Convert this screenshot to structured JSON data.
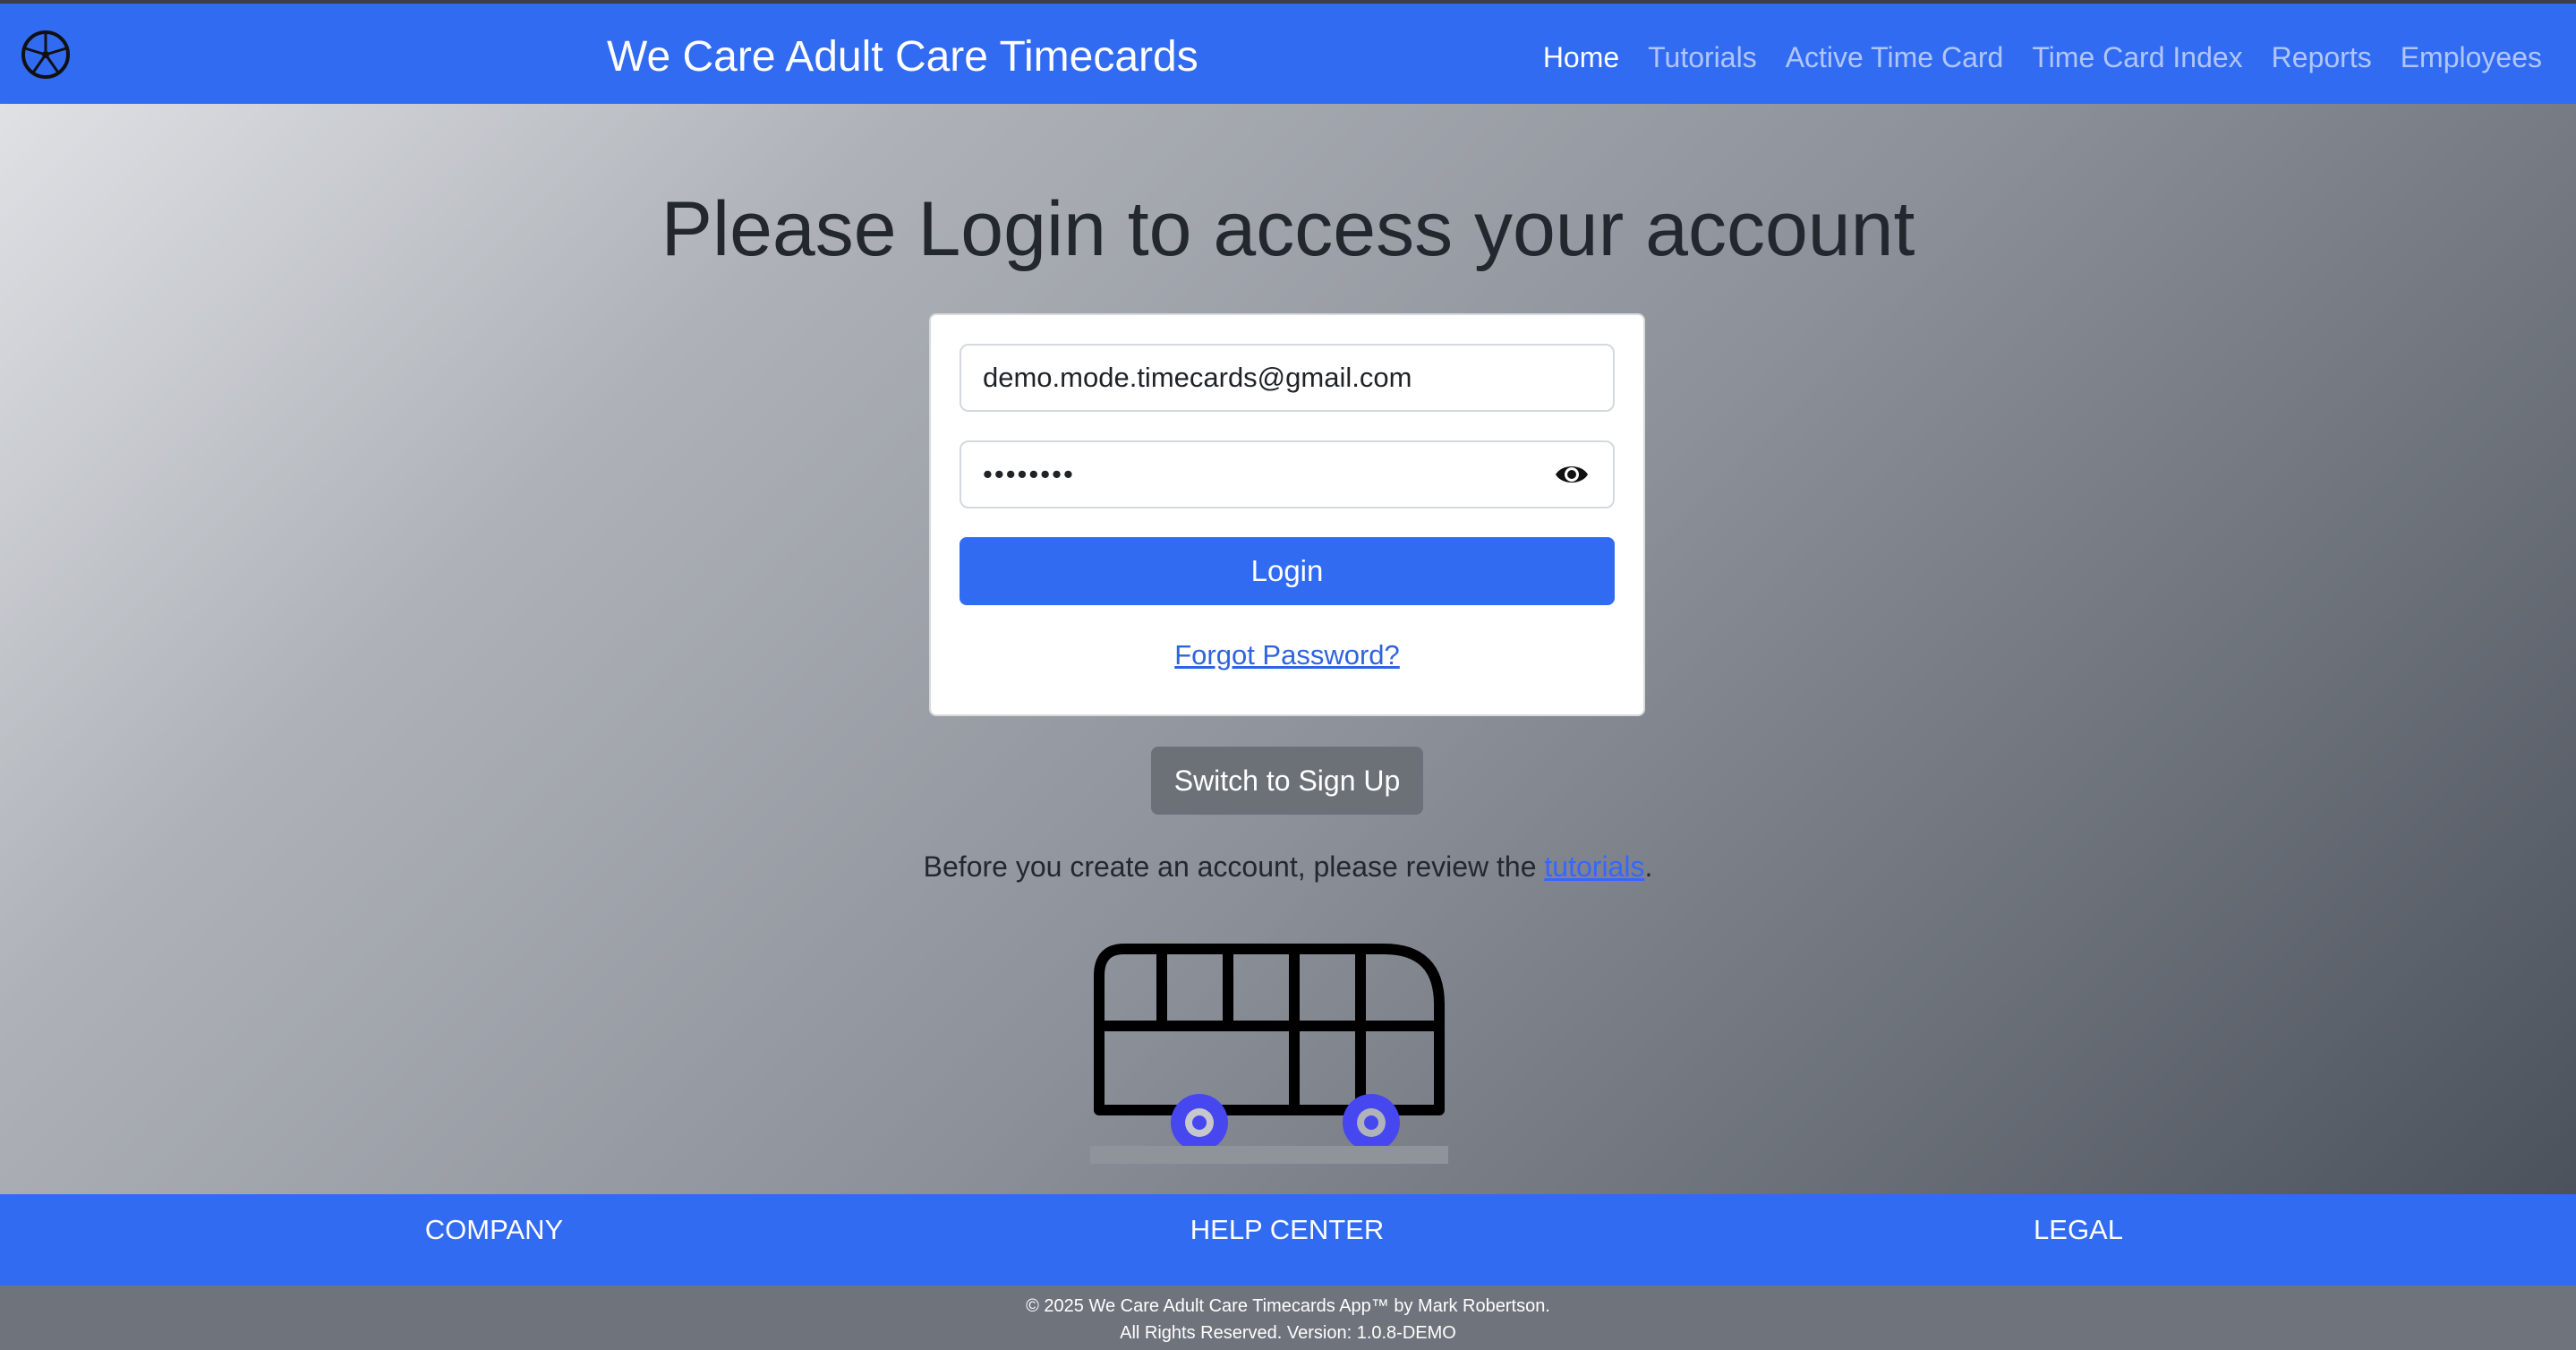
{
  "header": {
    "brand": "We Care Adult Care Timecards",
    "logo_icon": "wheel-icon",
    "nav": [
      {
        "label": "Home",
        "active": true
      },
      {
        "label": "Tutorials",
        "active": false
      },
      {
        "label": "Active Time Card",
        "active": false
      },
      {
        "label": "Time Card Index",
        "active": false
      },
      {
        "label": "Reports",
        "active": false
      },
      {
        "label": "Employees",
        "active": false
      }
    ]
  },
  "login": {
    "heading": "Please Login to access your account",
    "email_value": "demo.mode.timecards@gmail.com",
    "password_value": "demopass",
    "show_password_icon": "eye-icon",
    "login_label": "Login",
    "forgot_label": "Forgot Password?",
    "switch_label": "Switch to Sign Up",
    "note_before": "Before you create an account, please review the ",
    "note_link": "tutorials",
    "note_after": ".",
    "illustration_icon": "bus-icon"
  },
  "footer": {
    "links": [
      "COMPANY",
      "HELP CENTER",
      "LEGAL"
    ],
    "copyright_line1": "© 2025 We Care Adult Care Timecards App™ by Mark Robertson.",
    "copyright_line2": "All Rights Reserved. Version: 1.0.8-DEMO"
  },
  "colors": {
    "brand_blue": "#316bf2",
    "secondary_button": "#6c7178",
    "wheel_accent": "#4747f0"
  }
}
